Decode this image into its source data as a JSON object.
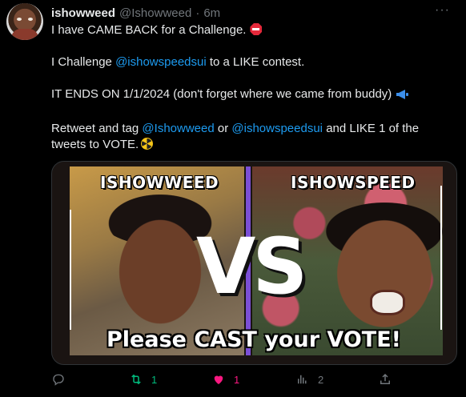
{
  "tweet": {
    "display_name": "ishowweed",
    "handle": "@Ishowweed",
    "separator": "·",
    "time": "6m",
    "more_label": "···",
    "line1": "I have CAME BACK for a Challenge.",
    "line2_prefix": "I Challenge",
    "line2_mention": "@ishowspeedsui",
    "line2_suffix": "to a LIKE contest.",
    "line3": "IT ENDS ON 1/1/2024 (don't forget where we came from buddy)",
    "line4_prefix": "Retweet and tag",
    "line4_mention1": "@Ishowweed",
    "line4_or": "or",
    "line4_mention2": "@ishowspeedsui",
    "line4_suffix": "and LIKE 1 of the",
    "line5": "tweets to VOTE."
  },
  "media": {
    "left_label": "ISHOWWEED",
    "right_label": "ISHOWSPEED",
    "center_text": "VS",
    "bottom_text": "Please CAST your VOTE!"
  },
  "actions": {
    "reply_count": "",
    "retweet_count": "1",
    "like_count": "1",
    "views_count": "2"
  },
  "colors": {
    "background": "#000000",
    "text": "#e7e9ea",
    "muted": "#71767b",
    "link": "#1d9bf0",
    "retweet": "#00ba7c",
    "like": "#f91880",
    "frame_accent": "#7b4fd6"
  },
  "icons": [
    "more-icon",
    "stop-sign-icon",
    "megaphone-icon",
    "radioactive-icon",
    "reply-icon",
    "retweet-icon",
    "like-icon",
    "views-icon",
    "share-icon"
  ]
}
